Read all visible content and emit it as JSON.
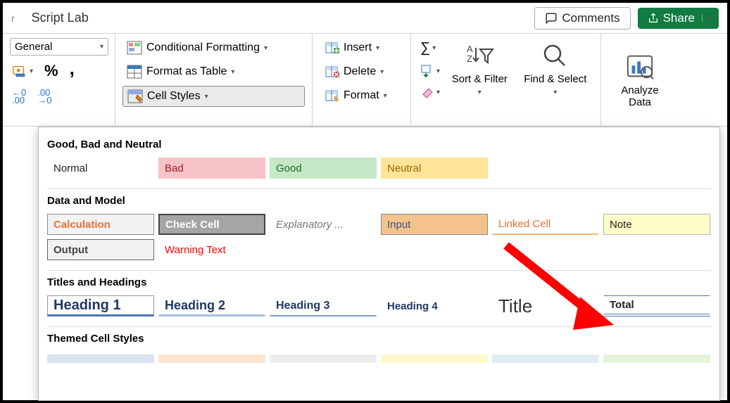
{
  "topbar": {
    "tab": "Script Lab",
    "comments": "Comments",
    "share": "Share"
  },
  "ribbon": {
    "numberFormat": "General",
    "condFormatting": "Conditional Formatting",
    "formatAsTable": "Format as Table",
    "cellStyles": "Cell Styles",
    "insert": "Insert",
    "delete": "Delete",
    "format": "Format",
    "sortFilter": "Sort & Filter",
    "findSelect": "Find & Select",
    "analyzeData": "Analyze Data"
  },
  "gallery": {
    "section1": "Good, Bad and Neutral",
    "gbn": {
      "normal": "Normal",
      "bad": "Bad",
      "good": "Good",
      "neutral": "Neutral"
    },
    "section2": "Data and Model",
    "dm": {
      "calculation": "Calculation",
      "checkCell": "Check Cell",
      "explanatory": "Explanatory ...",
      "input": "Input",
      "linkedCell": "Linked Cell",
      "note": "Note",
      "output": "Output",
      "warningText": "Warning Text"
    },
    "section3": "Titles and Headings",
    "th": {
      "heading1": "Heading 1",
      "heading2": "Heading 2",
      "heading3": "Heading 3",
      "heading4": "Heading 4",
      "title": "Title",
      "total": "Total"
    },
    "section4": "Themed Cell Styles"
  }
}
